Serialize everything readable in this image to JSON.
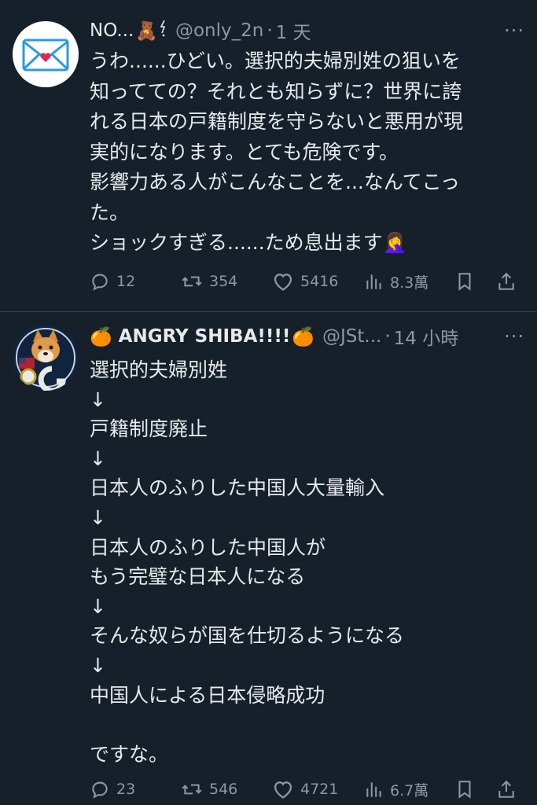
{
  "posts": [
    {
      "display_name": "NO...",
      "emoji_after_name": "🧸",
      "handle": "@only_2n",
      "separator": "·",
      "time": "1 天",
      "body": "うわ......ひどい。選択的夫婦別姓の狙いを\n知ってての？それとも知らずに？世界に誇\nれる日本の戸籍制度を守らないと悪用が現\n実的になります。とても危険です。\n影響力ある人がこんなことを...なんてこっ\nた。\nショックすぎる......ため息出ます🤦‍♀️",
      "replies": "12",
      "reposts": "354",
      "likes": "5416",
      "views": "8.3萬"
    },
    {
      "prefix_emoji": "🍊",
      "display_name": "ANGRY SHIBA!!!!",
      "suffix_emoji": "🍊",
      "handle": "@JSt...",
      "separator": "·",
      "time": "14 小時",
      "body": "選択的夫婦別姓\n↓\n戸籍制度廃止\n↓\n日本人のふりした中国人大量輸入\n↓\n日本人のふりした中国人が\nもう完璧な日本人になる\n↓\nそんな奴らが国を仕切るようになる\n↓\n中国人による日本侵略成功\n\nですな。",
      "replies": "23",
      "reposts": "546",
      "likes": "4721",
      "views": "6.7萬"
    }
  ],
  "more_label": "···",
  "colors": {
    "background": "#15202b",
    "text": "#e7e9ea",
    "muted": "#8b98a5",
    "divider": "#38444d",
    "mail_blue": "#2b9be0",
    "heart_red": "#e0245e"
  }
}
